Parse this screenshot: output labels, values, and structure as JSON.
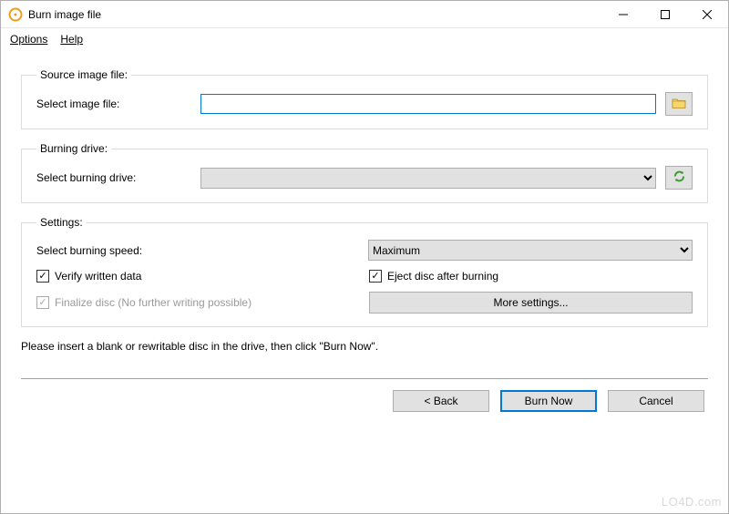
{
  "window": {
    "title": "Burn image file"
  },
  "menu": {
    "options": "Options",
    "help": "Help"
  },
  "source": {
    "legend": "Source image file:",
    "label": "Select image file:",
    "value": ""
  },
  "drive": {
    "legend": "Burning drive:",
    "label": "Select burning drive:",
    "value": ""
  },
  "settings": {
    "legend": "Settings:",
    "speed_label": "Select burning speed:",
    "speed_value": "Maximum",
    "verify_label": "Verify written data",
    "verify_checked": true,
    "eject_label": "Eject disc after burning",
    "eject_checked": true,
    "finalize_label": "Finalize disc (No further writing possible)",
    "finalize_checked": true,
    "finalize_enabled": false,
    "more_label": "More settings..."
  },
  "instruction": "Please insert a blank or rewritable disc in the drive, then click \"Burn Now\".",
  "buttons": {
    "back": "< Back",
    "burn": "Burn Now",
    "cancel": "Cancel"
  },
  "watermark": "LO4D.com"
}
